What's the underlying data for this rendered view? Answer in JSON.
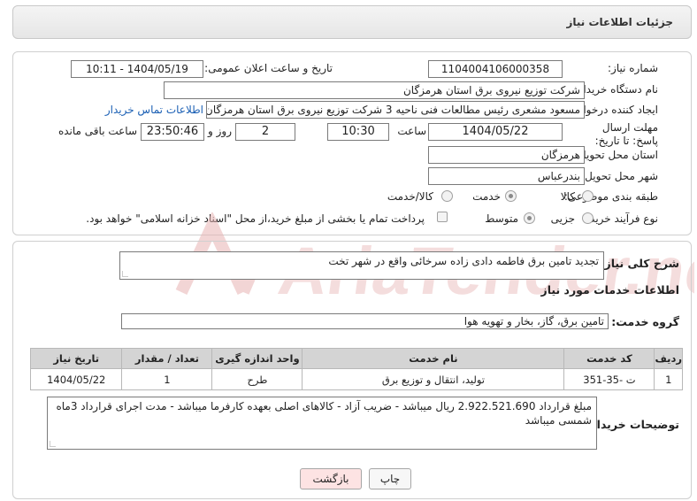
{
  "header": {
    "title": "جزئیات اطلاعات نیاز"
  },
  "form": {
    "need_number_label": "شماره نیاز:",
    "need_number": "1104004106000358",
    "announce_label": "تاریخ و ساعت اعلان عمومی:",
    "announce_value": "1404/05/19 - 10:11",
    "buyer_org_label": "نام دستگاه خریدار:",
    "buyer_org": "شرکت توزیع نیروی برق استان هرمزگان",
    "creator_label": "ایجاد کننده درخواست:",
    "creator": "مسعود مشعری رئیس مطالعات فنی ناحیه 3 شرکت توزیع نیروی برق استان هرمزگان",
    "contact_link": "اطلاعات تماس خریدار",
    "deadline_label": "مهلت ارسال پاسخ: تا تاریخ:",
    "deadline_date": "1404/05/22",
    "time_label": "ساعت",
    "deadline_time": "10:30",
    "days_value": "2",
    "days_label": "روز و",
    "remaining_time": "23:50:46",
    "remaining_label": "ساعت باقی مانده",
    "province_label": "استان محل تحویل:",
    "province": "هرمزگان",
    "city_label": "شهر محل تحویل:",
    "city": "بندرعباس",
    "category_label": "طبقه بندی موضوعی:",
    "category_options": [
      "کالا",
      "خدمت",
      "کالا/خدمت"
    ],
    "category_selected": "خدمت",
    "process_label": "نوع فرآیند خرید :",
    "process_options": [
      "جزیی",
      "متوسط"
    ],
    "process_selected": "متوسط",
    "payment_note": "پرداخت تمام یا بخشی از مبلغ خرید،از محل \"اسناد خزانه اسلامی\" خواهد بود."
  },
  "summary": {
    "label": "شرح کلی نیاز:",
    "text": "تجدید تامین برق فاطمه دادی زاده سرخائی واقع در شهر تخت"
  },
  "services": {
    "section_title": "اطلاعات خدمات مورد نیاز",
    "group_label": "گروه خدمت:",
    "group_value": "تامین برق، گاز، بخار و تهویه هوا",
    "columns": [
      "ردیف",
      "کد خدمت",
      "نام خدمت",
      "واحد اندازه گیری",
      "تعداد / مقدار",
      "تاریخ نیاز"
    ],
    "rows": [
      [
        "1",
        "ت -35-351",
        "تولید، انتقال و توزیع برق",
        "طرح",
        "1",
        "1404/05/22"
      ]
    ]
  },
  "buyer_notes": {
    "label": "توضیحات خریدار:",
    "text": "مبلغ قرارداد 2.922.521.690 ریال میباشد - ضریب آزاد - کالاهای اصلی بعهده کارفرما میباشد - مدت اجرای قرارداد 3ماه شمسی میباشد"
  },
  "buttons": {
    "print": "چاپ",
    "back": "بازگشت"
  },
  "watermark": {
    "text": "AriaTender.neT"
  },
  "colors": {
    "link": "#1a5fb4",
    "back_button_bg": "#fde3e3",
    "table_header_bg": "#d4d4d4",
    "watermark": "#e8b4b4"
  }
}
